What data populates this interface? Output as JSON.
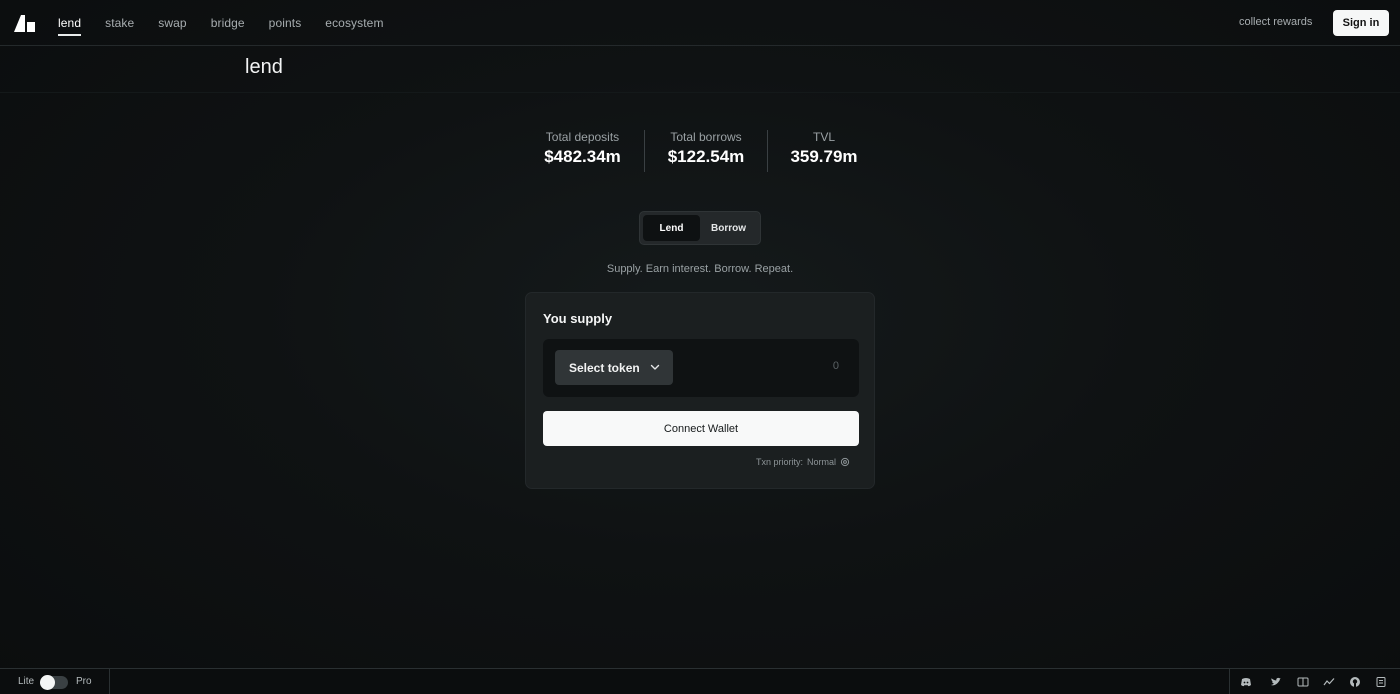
{
  "nav": {
    "items": [
      {
        "label": "lend",
        "active": true
      },
      {
        "label": "stake"
      },
      {
        "label": "swap"
      },
      {
        "label": "bridge"
      },
      {
        "label": "points"
      },
      {
        "label": "ecosystem"
      }
    ],
    "collect_rewards": "collect rewards",
    "sign_in": "Sign in"
  },
  "page": {
    "title": "lend"
  },
  "stats": [
    {
      "label": "Total deposits",
      "value": "$482.34m"
    },
    {
      "label": "Total borrows",
      "value": "$122.54m"
    },
    {
      "label": "TVL",
      "value": "359.79m"
    }
  ],
  "mode_toggle": {
    "options": [
      "Lend",
      "Borrow"
    ],
    "selected": "Lend"
  },
  "tagline": "Supply. Earn interest. Borrow. Repeat.",
  "supply_card": {
    "title": "You supply",
    "select_token": "Select token",
    "amount_placeholder": "0",
    "connect_wallet": "Connect Wallet",
    "txn_priority_label": "Txn priority:",
    "txn_priority_value": "Normal"
  },
  "footer": {
    "lite_label": "Lite",
    "pro_label": "Pro",
    "icons": [
      "discord-icon",
      "twitter-icon",
      "docs-icon",
      "analytics-icon",
      "github-icon"
    ]
  }
}
